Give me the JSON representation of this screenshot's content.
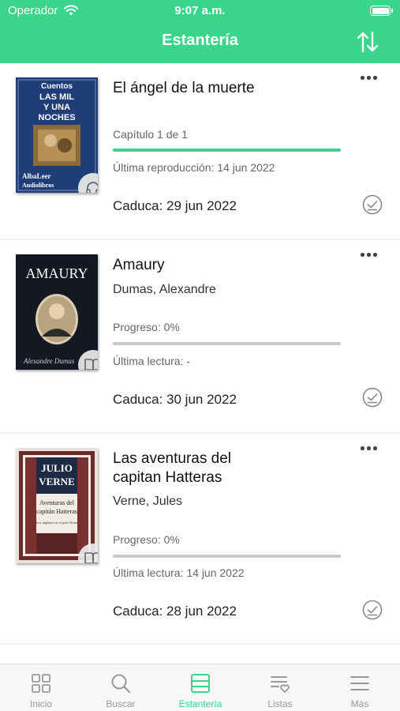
{
  "status_bar": {
    "carrier": "Operador",
    "time": "9:07 a.m."
  },
  "header": {
    "title": "Estantería",
    "sort_icon": "sort-arrows-icon"
  },
  "colors": {
    "accent": "#3ad58a",
    "progress_track": "#c9c9c9"
  },
  "books": [
    {
      "cover_text": [
        "Cuentos",
        "LAS MIL",
        "Y UNA",
        "NOCHES",
        "AlbaLeer",
        "Audiolibros"
      ],
      "title": "El ángel de la muerte",
      "format_icon": "headphones-icon",
      "progress_label": "Capítulo 1 de 1",
      "progress": 1.0,
      "last_label": "Última reproducción: 14 jun 2022",
      "expiry": "Caduca: 29 jun 2022"
    },
    {
      "cover_text": [
        "AMAURY",
        "Alexandre Dumas"
      ],
      "title": "Amaury",
      "author": "Dumas, Alexandre",
      "format_icon": "book-icon",
      "progress_label": "Progreso: 0%",
      "progress": 0,
      "last_label": "Última lectura: -",
      "expiry": "Caduca: 30 jun 2022"
    },
    {
      "cover_text": [
        "JULIO",
        "VERNE",
        "Aventuras del",
        "capitán Hatteras",
        "Los ingleses en el polo Norte"
      ],
      "title": "Las aventuras del capitan Hatteras",
      "author": "Verne, Jules",
      "format_icon": "book-icon",
      "progress_label": "Progreso: 0%",
      "progress": 0,
      "last_label": "Última lectura: 14 jun 2022",
      "expiry": "Caduca: 28 jun 2022"
    }
  ],
  "tabbar": {
    "items": [
      {
        "label": "Inicio",
        "icon": "grid-icon",
        "active": false
      },
      {
        "label": "Buscar",
        "icon": "search-icon",
        "active": false
      },
      {
        "label": "Estantería",
        "icon": "shelf-icon",
        "active": true
      },
      {
        "label": "Listas",
        "icon": "list-heart-icon",
        "active": false
      },
      {
        "label": "Más",
        "icon": "menu-icon",
        "active": false
      }
    ]
  }
}
